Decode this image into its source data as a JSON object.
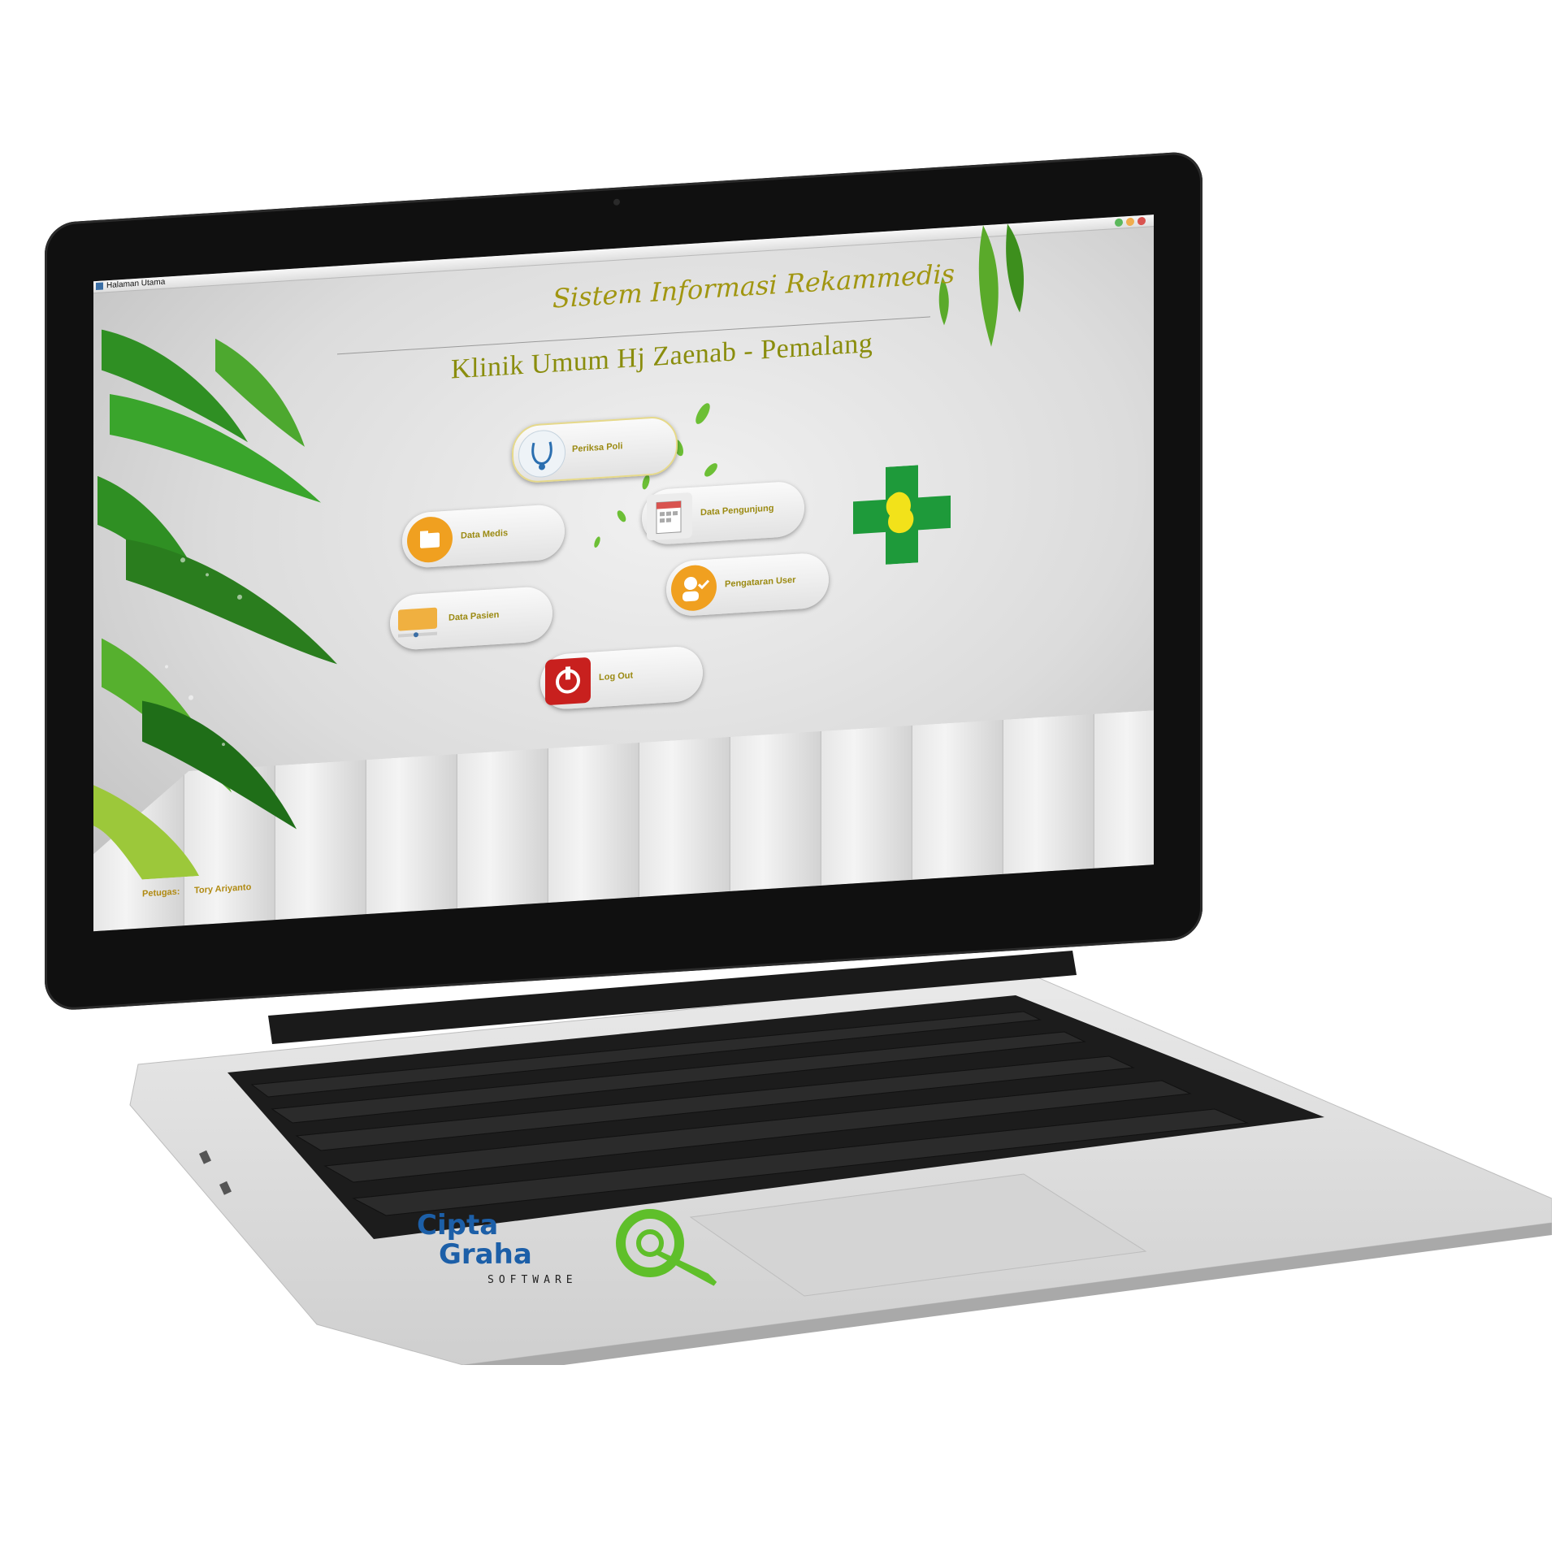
{
  "window": {
    "title": "Halaman Utama"
  },
  "header": {
    "title": "Sistem Informasi Rekammedis",
    "subtitle": "Klinik Umum Hj Zaenab - Pemalang"
  },
  "menu": {
    "periksa_poli": "Periksa Poli",
    "data_medis": "Data Medis",
    "data_pengunjung": "Data Pengunjung",
    "data_pasien": "Data Pasien",
    "pengaturan_user": "Pengataran User",
    "log_out": "Log Out"
  },
  "footer": {
    "label": "Petugas:",
    "value": "Tory Ariyanto"
  },
  "brand": {
    "line1": "Cipta",
    "line2": "Graha",
    "line3": "SOFTWARE"
  },
  "icons": {
    "periksa_poli": "stethoscope-icon",
    "data_medis": "folder-icon",
    "data_pengunjung": "clipboard-calendar-icon",
    "data_pasien": "patient-card-icon",
    "pengaturan_user": "user-check-icon",
    "log_out": "power-icon"
  },
  "colors": {
    "title_text": "#a19611",
    "button_label": "#9b8a12",
    "accent_orange": "#f0a020",
    "logout_red": "#c8201e",
    "clinic_green": "#1e9a3a",
    "brand_blue": "#1c5fa8",
    "brand_green": "#5fbf2a"
  }
}
